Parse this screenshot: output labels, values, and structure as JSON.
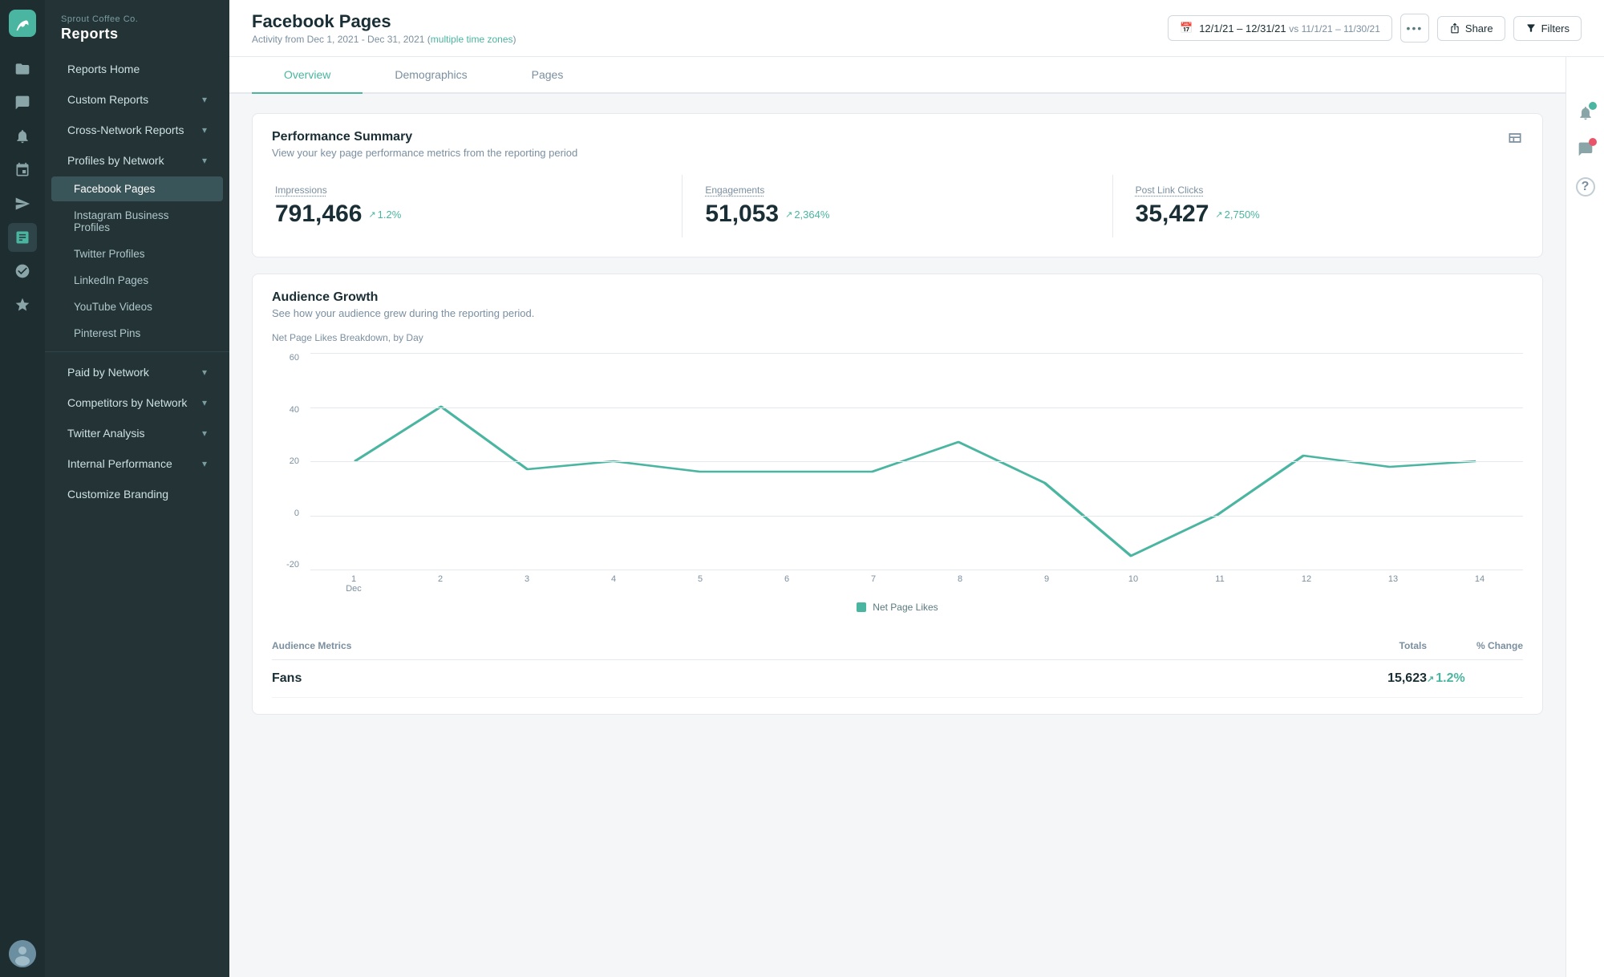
{
  "app": {
    "company": "Sprout Coffee Co.",
    "section": "Reports"
  },
  "page": {
    "title": "Facebook Pages",
    "subtitle": "Activity from Dec 1, 2021 - Dec 31, 2021",
    "timezone_text": "multiple time zones",
    "date_range": "12/1/21 – 12/31/21",
    "compare_range": "vs 11/1/21 – 11/30/21"
  },
  "tabs": [
    {
      "label": "Overview",
      "active": true
    },
    {
      "label": "Demographics",
      "active": false
    },
    {
      "label": "Pages",
      "active": false
    }
  ],
  "performance": {
    "title": "Performance Summary",
    "subtitle": "View your key page performance metrics from the reporting period",
    "metrics": [
      {
        "label": "Impressions",
        "value": "791,466",
        "change": "1.2%",
        "direction": "up"
      },
      {
        "label": "Engagements",
        "value": "51,053",
        "change": "2,364%",
        "direction": "up"
      },
      {
        "label": "Post Link Clicks",
        "value": "35,427",
        "change": "2,750%",
        "direction": "up"
      }
    ]
  },
  "audience_growth": {
    "title": "Audience Growth",
    "subtitle": "See how your audience grew during the reporting period.",
    "chart_label": "Net Page Likes Breakdown, by Day",
    "y_labels": [
      "60",
      "40",
      "20",
      "0",
      "-20"
    ],
    "x_labels": [
      "1\nDec",
      "2",
      "3",
      "4",
      "5",
      "6",
      "7",
      "8",
      "9",
      "10",
      "11",
      "12",
      "13",
      "14"
    ],
    "legend": "Net Page Likes"
  },
  "audience_metrics": {
    "title": "Audience Metrics",
    "col_totals": "Totals",
    "col_change": "% Change",
    "rows": [
      {
        "name": "Fans",
        "total": "15,623",
        "change": "1.2%",
        "direction": "up"
      }
    ]
  },
  "sidebar": {
    "items": [
      {
        "label": "Reports Home",
        "level": "top",
        "active": false
      },
      {
        "label": "Custom Reports",
        "level": "top",
        "has_chevron": true
      },
      {
        "label": "Cross-Network Reports",
        "level": "top",
        "has_chevron": true
      },
      {
        "label": "Profiles by Network",
        "level": "top",
        "has_chevron": true,
        "expanded": true
      },
      {
        "label": "Facebook Pages",
        "level": "sub",
        "active": true
      },
      {
        "label": "Instagram Business Profiles",
        "level": "sub",
        "active": false
      },
      {
        "label": "Twitter Profiles",
        "level": "sub",
        "active": false
      },
      {
        "label": "LinkedIn Pages",
        "level": "sub",
        "active": false
      },
      {
        "label": "YouTube Videos",
        "level": "sub",
        "active": false
      },
      {
        "label": "Pinterest Pins",
        "level": "sub",
        "active": false
      },
      {
        "label": "Paid by Network",
        "level": "top",
        "has_chevron": true
      },
      {
        "label": "Competitors by Network",
        "level": "top",
        "has_chevron": true
      },
      {
        "label": "Twitter Analysis",
        "level": "top",
        "has_chevron": true
      },
      {
        "label": "Internal Performance",
        "level": "top",
        "has_chevron": true
      },
      {
        "label": "Customize Branding",
        "level": "top",
        "has_chevron": false
      }
    ]
  },
  "icons": {
    "logo": "🌱",
    "bell": "🔔",
    "chat": "💬",
    "help": "?",
    "calendar": "📅",
    "share": "↑",
    "filter": "⊟",
    "more": "•••",
    "compose": "+",
    "grid": "⊞",
    "folder": "📁",
    "pin": "📌",
    "chart": "📊",
    "robot": "🤖",
    "star": "★"
  }
}
